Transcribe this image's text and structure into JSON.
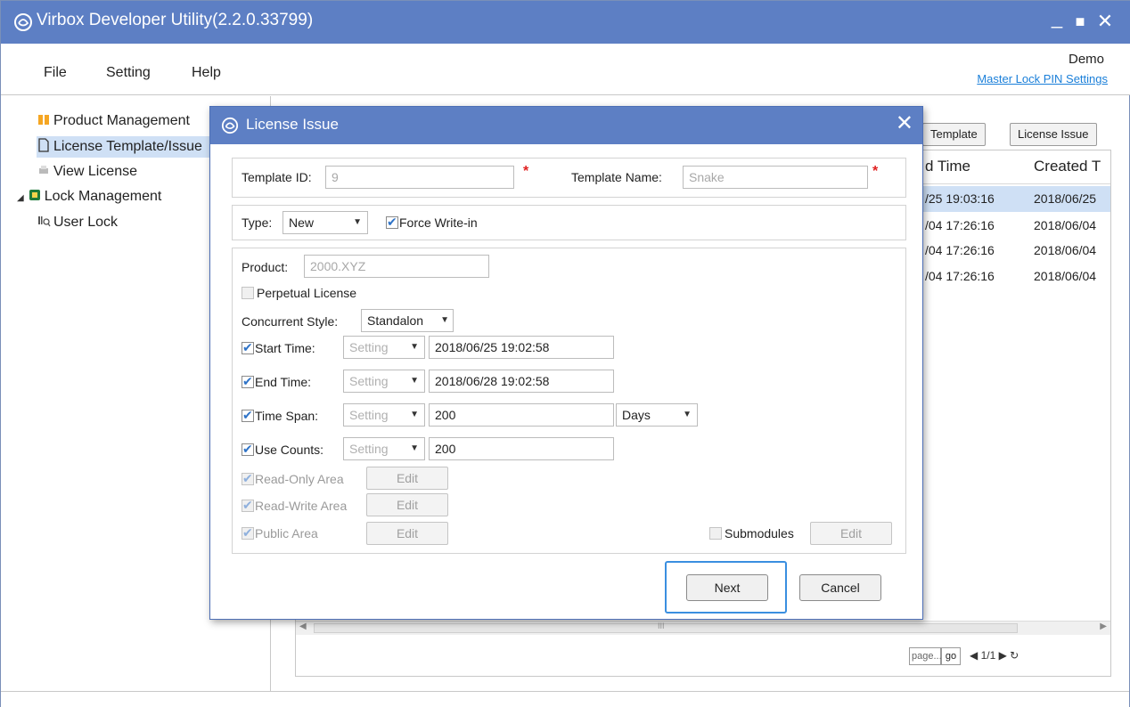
{
  "window": {
    "title": "Virbox Developer Utility(2.2.0.33799)",
    "minimize": "_",
    "maximize": "■",
    "close": "✕"
  },
  "menu": {
    "file": "File",
    "setting": "Setting",
    "help": "Help",
    "user": "Demo",
    "pin_link": "Master Lock PIN Settings"
  },
  "sidebar": {
    "items": [
      {
        "label": "Product Management"
      },
      {
        "label": "License Template/Issue"
      },
      {
        "label": "View License"
      },
      {
        "label": "Lock Management"
      },
      {
        "label": "User Lock"
      }
    ]
  },
  "main": {
    "template_btn": "Template",
    "license_issue_btn": "License Issue",
    "columns": [
      "d Time",
      "Created T"
    ],
    "rows": [
      [
        "/25 19:03:16",
        "2018/06/25"
      ],
      [
        "/04 17:26:16",
        "2018/06/04"
      ],
      [
        "/04 17:26:16",
        "2018/06/04"
      ],
      [
        "/04 17:26:16",
        "2018/06/04"
      ]
    ],
    "scroll_marker": "III",
    "pager_placeholder": "page...",
    "pager_go": "go",
    "pager_info": "◀ 1/1 ▶  ↻"
  },
  "dialog": {
    "title": "License Issue",
    "close": "✕",
    "template_id_label": "Template ID:",
    "template_id": "9",
    "template_name_label": "Template Name:",
    "template_name": "Snake",
    "required_mark": "*",
    "type_label": "Type:",
    "type_value": "New",
    "force_write_label": "Force Write-in",
    "product_label": "Product:",
    "product_value": "2000.XYZ",
    "perpetual_label": "Perpetual License",
    "concurrent_label": "Concurrent Style:",
    "concurrent_value": "Standalon",
    "start_time_label": "Start Time:",
    "start_time_mode": "Setting",
    "start_time_value": "2018/06/25 19:02:58",
    "end_time_label": "End Time:",
    "end_time_mode": "Setting",
    "end_time_value": "2018/06/28 19:02:58",
    "time_span_label": "Time Span:",
    "time_span_mode": "Setting",
    "time_span_value": "200",
    "time_span_unit": "Days",
    "use_counts_label": "Use Counts:",
    "use_counts_mode": "Setting",
    "use_counts_value": "200",
    "read_only_label": "Read-Only Area",
    "read_write_label": "Read-Write Area",
    "public_label": "Public Area",
    "edit": "Edit",
    "submodules_label": "Submodules",
    "next": "Next",
    "cancel": "Cancel"
  },
  "colors": {
    "titlebar": "#5d7fc4",
    "selection": "#cfe0f5",
    "link": "#1a7fd9",
    "required": "#e02020",
    "focus": "#3a8fe0"
  }
}
